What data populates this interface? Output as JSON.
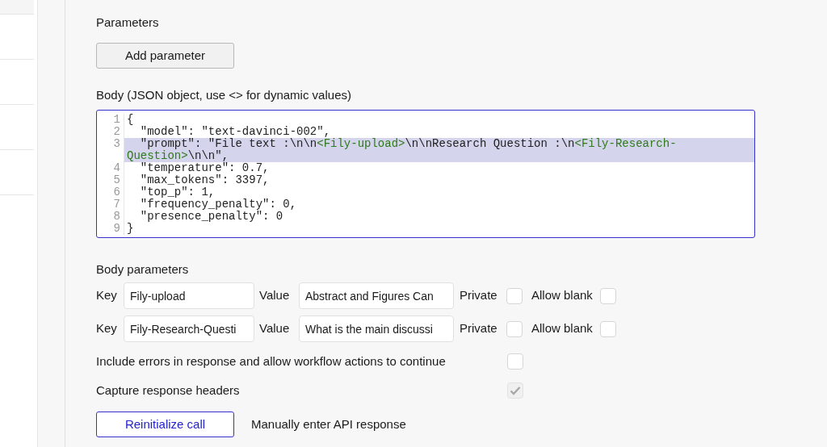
{
  "parameters": {
    "heading": "Parameters",
    "add_button": "Add parameter"
  },
  "body": {
    "label": "Body (JSON object, use <> for dynamic values)",
    "lines": [
      {
        "number": "1",
        "text": "{",
        "highlighted": false
      },
      {
        "number": "2",
        "text": "  \"model\": \"text-davinci-002\",",
        "highlighted": false
      },
      {
        "number": "3",
        "text": "  \"prompt\": \"File text :\\n\\n<Fily-upload>\\n\\nResearch Question :\\n<Fily-Research-Question>\\n\\n\",",
        "highlighted": true
      },
      {
        "number": "4",
        "text": "  \"temperature\": 0.7,",
        "highlighted": false
      },
      {
        "number": "5",
        "text": "  \"max_tokens\": 3397,",
        "highlighted": false
      },
      {
        "number": "6",
        "text": "  \"top_p\": 1,",
        "highlighted": false
      },
      {
        "number": "7",
        "text": "  \"frequency_penalty\": 0,",
        "highlighted": false
      },
      {
        "number": "8",
        "text": "  \"presence_penalty\": 0",
        "highlighted": false
      },
      {
        "number": "9",
        "text": "}",
        "highlighted": false
      }
    ]
  },
  "body_parameters": {
    "heading": "Body parameters",
    "rows": [
      {
        "key_label": "Key",
        "key": "Fily-upload",
        "value_label": "Value",
        "value": "Abstract and Figures Can",
        "private_label": "Private",
        "private": false,
        "allow_blank_label": "Allow blank",
        "allow_blank": false
      },
      {
        "key_label": "Key",
        "key": "Fily-Research-Questi",
        "value_label": "Value",
        "value": "What is the main discussi",
        "private_label": "Private",
        "private": false,
        "allow_blank_label": "Allow blank",
        "allow_blank": false
      }
    ]
  },
  "options": [
    {
      "label": "Include errors in response and allow workflow actions to continue",
      "checked": false,
      "disabled": false
    },
    {
      "label": "Capture response headers",
      "checked": true,
      "disabled": true
    }
  ],
  "reinitialize_button": "Reinitialize call",
  "manual_link": "Manually enter API response"
}
